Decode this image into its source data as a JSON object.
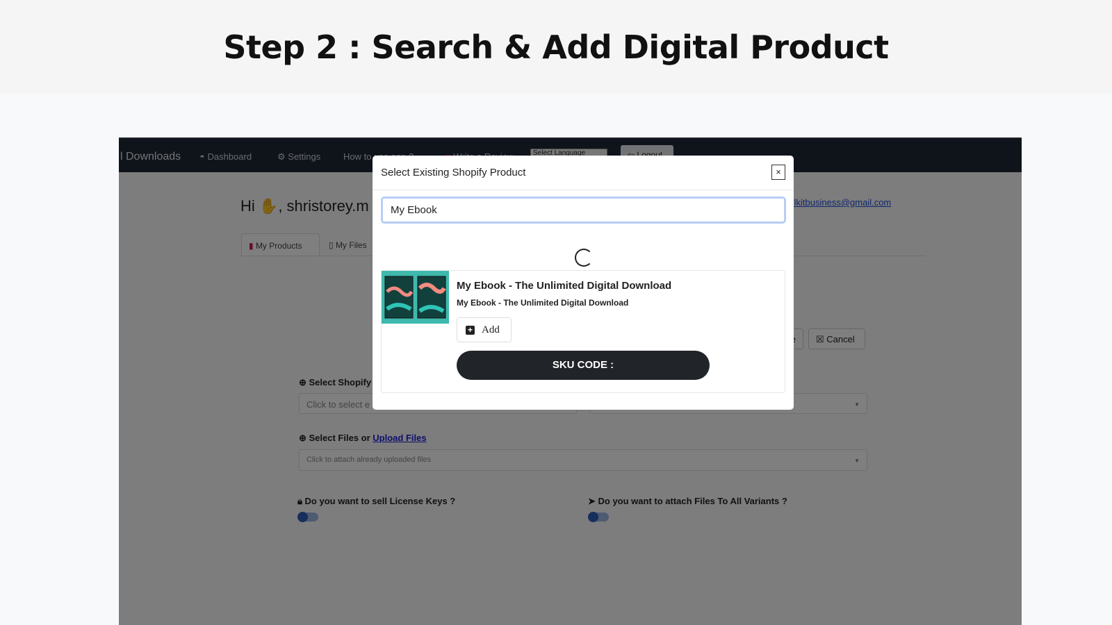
{
  "hero": {
    "title": "Step 2 : Search & Add Digital Product"
  },
  "nav": {
    "brand": "l Downloads",
    "dashboard": "Dashboard",
    "settings": "Settings",
    "how_to": "How to use app ?",
    "review": "Write a Review",
    "language": "Select Language",
    "logout": "Logout"
  },
  "page": {
    "greeting": "Hi",
    "user": ", shristorey.m",
    "email": "sellkitbusiness@gmail.com",
    "tabs": [
      {
        "label": "My Products"
      },
      {
        "label": "My Files"
      }
    ],
    "save_partial": "e",
    "cancel": "Cancel",
    "select_product_label": "Select Shopify",
    "select_product_placeholder": "Click to select e",
    "select_files_label": "Select Files or",
    "upload_files_link": "Upload Files",
    "select_files_placeholder": "Click to attach already uploaded files",
    "license_keys": "Do you want to sell License Keys ?",
    "attach_all": "Do you want to attach Files To All Variants ?"
  },
  "modal": {
    "title": "Select Existing Shopify Product",
    "close": "×",
    "search_value": "My Ebook",
    "result": {
      "title": "My Ebook - The Unlimited Digital Download",
      "subtitle": "My Ebook - The Unlimited Digital Download",
      "add": "Add",
      "sku": "SKU CODE :"
    }
  },
  "colors": {
    "navbar": "#1f2937",
    "accent": "#1d4ed8",
    "dark_button": "#212529",
    "focus": "#b9cdf5"
  }
}
